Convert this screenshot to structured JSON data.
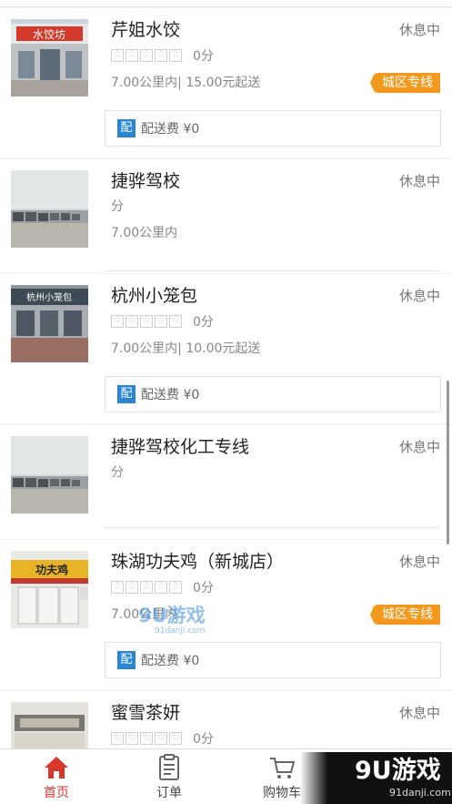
{
  "stores": [
    {
      "name": "芹姐水饺",
      "status": "休息中",
      "show_stars": true,
      "score": "0分",
      "distance": "7.00公里内| 15.00元起送",
      "tag": "城区专线",
      "delivery_badge": "配",
      "delivery_text": "配送费 ¥0"
    },
    {
      "name": "捷骅驾校",
      "status": "休息中",
      "show_stars": false,
      "score": "分",
      "distance": "7.00公里内",
      "tag": "",
      "delivery_badge": "",
      "delivery_text": ""
    },
    {
      "name": "杭州小笼包",
      "status": "休息中",
      "show_stars": true,
      "score": "0分",
      "distance": "7.00公里内| 10.00元起送",
      "tag": "",
      "delivery_badge": "配",
      "delivery_text": "配送费 ¥0"
    },
    {
      "name": "捷骅驾校化工专线",
      "status": "休息中",
      "show_stars": false,
      "score": "分",
      "distance": "",
      "tag": "",
      "delivery_badge": "",
      "delivery_text": ""
    },
    {
      "name": "珠湖功夫鸡（新城店）",
      "status": "休息中",
      "show_stars": true,
      "score": "0分",
      "distance": "7.00公里内",
      "tag": "城区专线",
      "delivery_badge": "配",
      "delivery_text": "配送费 ¥0"
    },
    {
      "name": "蜜雪茶妍",
      "status": "休息中",
      "show_stars": true,
      "score": "0分",
      "distance": "",
      "tag": "",
      "delivery_badge": "",
      "delivery_text": ""
    }
  ],
  "thumb_text": {
    "store0_sign": "水饺坊",
    "store2_sign": "杭州小笼包",
    "store4_sign": "功夫鸡"
  },
  "watermark": {
    "main": "9U游戏",
    "sub": "91danji.com"
  },
  "corner_logo": {
    "main": "9U游戏",
    "sub": "91danji.com"
  },
  "tabs": [
    {
      "label": "首页",
      "icon": "home-icon",
      "active": true
    },
    {
      "label": "订单",
      "icon": "order-icon",
      "active": false
    },
    {
      "label": "购物车",
      "icon": "cart-icon",
      "active": false
    }
  ],
  "colors": {
    "accent": "#d9372e",
    "tag": "#f39a1e",
    "badge": "#2a86d4"
  }
}
